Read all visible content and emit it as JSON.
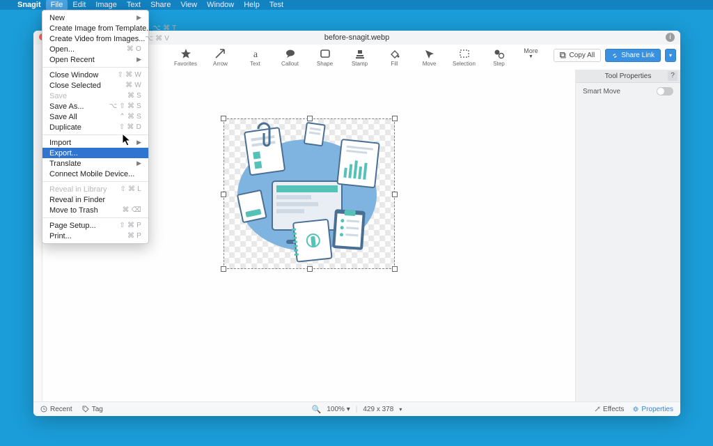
{
  "menubar": {
    "app": "Snagit",
    "items": [
      "File",
      "Edit",
      "Image",
      "Text",
      "Share",
      "View",
      "Window",
      "Help",
      "Test"
    ],
    "active_index": 0
  },
  "window": {
    "title": "before-snagit.webp"
  },
  "toolbar": {
    "tools": [
      {
        "label": "Favorites",
        "icon": "star"
      },
      {
        "label": "Arrow",
        "icon": "arrow"
      },
      {
        "label": "Text",
        "icon": "text"
      },
      {
        "label": "Callout",
        "icon": "callout"
      },
      {
        "label": "Shape",
        "icon": "shape"
      },
      {
        "label": "Stamp",
        "icon": "stamp"
      },
      {
        "label": "Fill",
        "icon": "fill"
      },
      {
        "label": "Move",
        "icon": "move"
      },
      {
        "label": "Selection",
        "icon": "selection"
      },
      {
        "label": "Step",
        "icon": "step"
      }
    ],
    "more": "More",
    "copy_all": "Copy All",
    "share_link": "Share Link"
  },
  "right_panel": {
    "title": "Tool Properties",
    "rows": [
      {
        "label": "Smart Move",
        "value": false
      }
    ]
  },
  "status": {
    "recent": "Recent",
    "tag": "Tag",
    "zoom": "100%",
    "dims": "429 x 378",
    "effects": "Effects",
    "properties": "Properties"
  },
  "file_menu": [
    {
      "label": "New",
      "shortcut": "",
      "arrow": true
    },
    {
      "label": "Create Image from Template...",
      "shortcut": "⌥ ⌘ T"
    },
    {
      "label": "Create Video from Images...",
      "shortcut": "⌥ ⌘ V"
    },
    {
      "label": "Open...",
      "shortcut": "⌘ O"
    },
    {
      "label": "Open Recent",
      "shortcut": "",
      "arrow": true
    },
    {
      "sep": true
    },
    {
      "label": "Close Window",
      "shortcut": "⇧ ⌘ W"
    },
    {
      "label": "Close Selected",
      "shortcut": "⌘ W"
    },
    {
      "label": "Save",
      "shortcut": "⌘ S",
      "disabled": true
    },
    {
      "label": "Save As...",
      "shortcut": "⌥ ⇧ ⌘ S"
    },
    {
      "label": "Save All",
      "shortcut": "⌃ ⌘ S"
    },
    {
      "label": "Duplicate",
      "shortcut": "⇧ ⌘ D"
    },
    {
      "sep": true
    },
    {
      "label": "Import",
      "shortcut": "",
      "arrow": true
    },
    {
      "label": "Export...",
      "shortcut": "",
      "highlight": true
    },
    {
      "label": "Translate",
      "shortcut": "",
      "arrow": true
    },
    {
      "label": "Connect Mobile Device...",
      "shortcut": ""
    },
    {
      "sep": true
    },
    {
      "label": "Reveal in Library",
      "shortcut": "⇧ ⌘ L",
      "disabled": true
    },
    {
      "label": "Reveal in Finder",
      "shortcut": ""
    },
    {
      "label": "Move to Trash",
      "shortcut": "⌘ ⌫"
    },
    {
      "sep": true
    },
    {
      "label": "Page Setup...",
      "shortcut": "⇧ ⌘ P"
    },
    {
      "label": "Print...",
      "shortcut": "⌘ P"
    }
  ]
}
